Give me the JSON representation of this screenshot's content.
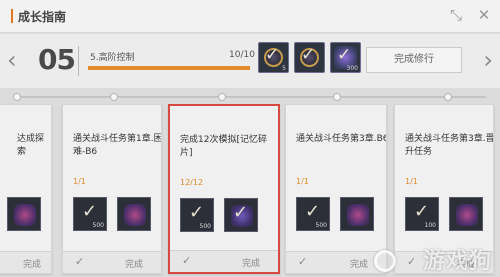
{
  "header": {
    "title": "成长指南"
  },
  "stage": {
    "number": "05",
    "name": "5.高阶控制",
    "count": "10/10",
    "progress": 1.0,
    "rewards": [
      {
        "icon": "checked-reward-icon",
        "qty": "5"
      },
      {
        "icon": "checked-reward-icon",
        "qty": ""
      },
      {
        "icon": "checked-reward-icon",
        "qty": "300"
      }
    ],
    "complete_label": "完成修行"
  },
  "cards": [
    {
      "title": "达成探索",
      "progress": "",
      "qty1": "",
      "qty2": "",
      "done": "完成",
      "selected": false
    },
    {
      "title": "通关战斗任务第1章.困难-B6",
      "progress": "1/1",
      "qty1": "500",
      "qty2": "",
      "done": "完成",
      "selected": false
    },
    {
      "title": "完成12次模拟[记忆碎片]",
      "progress": "12/12",
      "qty1": "500",
      "qty2": "",
      "done": "完成",
      "selected": true
    },
    {
      "title": "通关战斗任务第3章.B6",
      "progress": "1/1",
      "qty1": "500",
      "qty2": "",
      "done": "完成",
      "selected": false
    },
    {
      "title": "通关战斗任务第3章.晋升任务",
      "progress": "1/1",
      "qty1": "100",
      "qty2": "",
      "done": "完成",
      "selected": false
    }
  ],
  "watermark": "游戏狗",
  "colors": {
    "accent": "#e2761f",
    "selected_border": "#d84a3f",
    "progress_fill": "#e38b2c"
  }
}
